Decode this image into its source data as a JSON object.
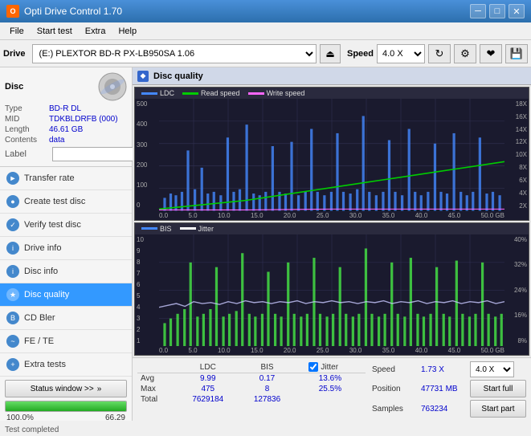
{
  "app": {
    "title": "Opti Drive Control 1.70",
    "icon": "O"
  },
  "titlebar": {
    "minimize": "─",
    "maximize": "□",
    "close": "✕"
  },
  "menubar": {
    "items": [
      "File",
      "Start test",
      "Extra",
      "Help"
    ]
  },
  "toolbar": {
    "drive_label": "Drive",
    "drive_value": "(E:) PLEXTOR BD-R  PX-LB950SA 1.06",
    "speed_label": "Speed",
    "speed_value": "4.0 X"
  },
  "disc": {
    "title": "Disc",
    "type_label": "Type",
    "type_value": "BD-R DL",
    "mid_label": "MID",
    "mid_value": "TDKBLDRFB (000)",
    "length_label": "Length",
    "length_value": "46.61 GB",
    "contents_label": "Contents",
    "contents_value": "data",
    "label_label": "Label",
    "label_value": ""
  },
  "nav": {
    "items": [
      {
        "id": "transfer-rate",
        "label": "Transfer rate",
        "icon": "►"
      },
      {
        "id": "create-test-disc",
        "label": "Create test disc",
        "icon": "●"
      },
      {
        "id": "verify-test-disc",
        "label": "Verify test disc",
        "icon": "✓"
      },
      {
        "id": "drive-info",
        "label": "Drive info",
        "icon": "i"
      },
      {
        "id": "disc-info",
        "label": "Disc info",
        "icon": "i"
      },
      {
        "id": "disc-quality",
        "label": "Disc quality",
        "icon": "★",
        "active": true
      },
      {
        "id": "cd-bler",
        "label": "CD Bler",
        "icon": "B"
      },
      {
        "id": "fe-te",
        "label": "FE / TE",
        "icon": "~"
      },
      {
        "id": "extra-tests",
        "label": "Extra tests",
        "icon": "+"
      }
    ]
  },
  "status": {
    "button_label": "Status window >>",
    "progress": 100.0,
    "progress_text": "100.0%",
    "speed_text": "66.29",
    "status_text": "Test completed"
  },
  "quality": {
    "title": "Disc quality",
    "chart1": {
      "legend": [
        {
          "label": "LDC",
          "color": "#4488ff",
          "type": "ldc"
        },
        {
          "label": "Read speed",
          "color": "#00cc00",
          "type": "read"
        },
        {
          "label": "Write speed",
          "color": "#ff66ff",
          "type": "write"
        }
      ],
      "y_axis_left": [
        "500",
        "400",
        "300",
        "200",
        "100",
        "0"
      ],
      "y_axis_right": [
        "18X",
        "16X",
        "14X",
        "12X",
        "10X",
        "8X",
        "6X",
        "4X",
        "2X"
      ],
      "x_axis": [
        "0.0",
        "5.0",
        "10.0",
        "15.0",
        "20.0",
        "25.0",
        "30.0",
        "35.0",
        "40.0",
        "45.0",
        "50.0 GB"
      ]
    },
    "chart2": {
      "legend": [
        {
          "label": "BIS",
          "color": "#4488ff",
          "type": "bis"
        },
        {
          "label": "Jitter",
          "color": "#ffffff",
          "type": "jitter"
        }
      ],
      "y_axis_left": [
        "10",
        "9",
        "8",
        "7",
        "6",
        "5",
        "4",
        "3",
        "2",
        "1"
      ],
      "y_axis_right": [
        "40%",
        "32%",
        "24%",
        "16%",
        "8%"
      ],
      "x_axis": [
        "0.0",
        "5.0",
        "10.0",
        "15.0",
        "20.0",
        "25.0",
        "30.0",
        "35.0",
        "40.0",
        "45.0",
        "50.0 GB"
      ]
    }
  },
  "stats": {
    "headers": [
      "LDC",
      "BIS",
      "",
      "Jitter",
      "Speed",
      "",
      ""
    ],
    "rows": [
      {
        "label": "Avg",
        "ldc": "9.99",
        "bis": "0.17",
        "jitter": "13.6%",
        "speed_label": "Position",
        "speed_val": "47731 MB"
      },
      {
        "label": "Max",
        "ldc": "475",
        "bis": "8",
        "jitter": "25.5%",
        "speed_label": "Samples",
        "speed_val": "763234"
      },
      {
        "label": "Total",
        "ldc": "7629184",
        "bis": "127836",
        "jitter": ""
      }
    ],
    "jitter_checked": true,
    "jitter_label": "Jitter",
    "speed_label": "Speed",
    "speed_val": "1.73 X",
    "speed_select": "4.0 X",
    "start_full_label": "Start full",
    "start_part_label": "Start part"
  }
}
